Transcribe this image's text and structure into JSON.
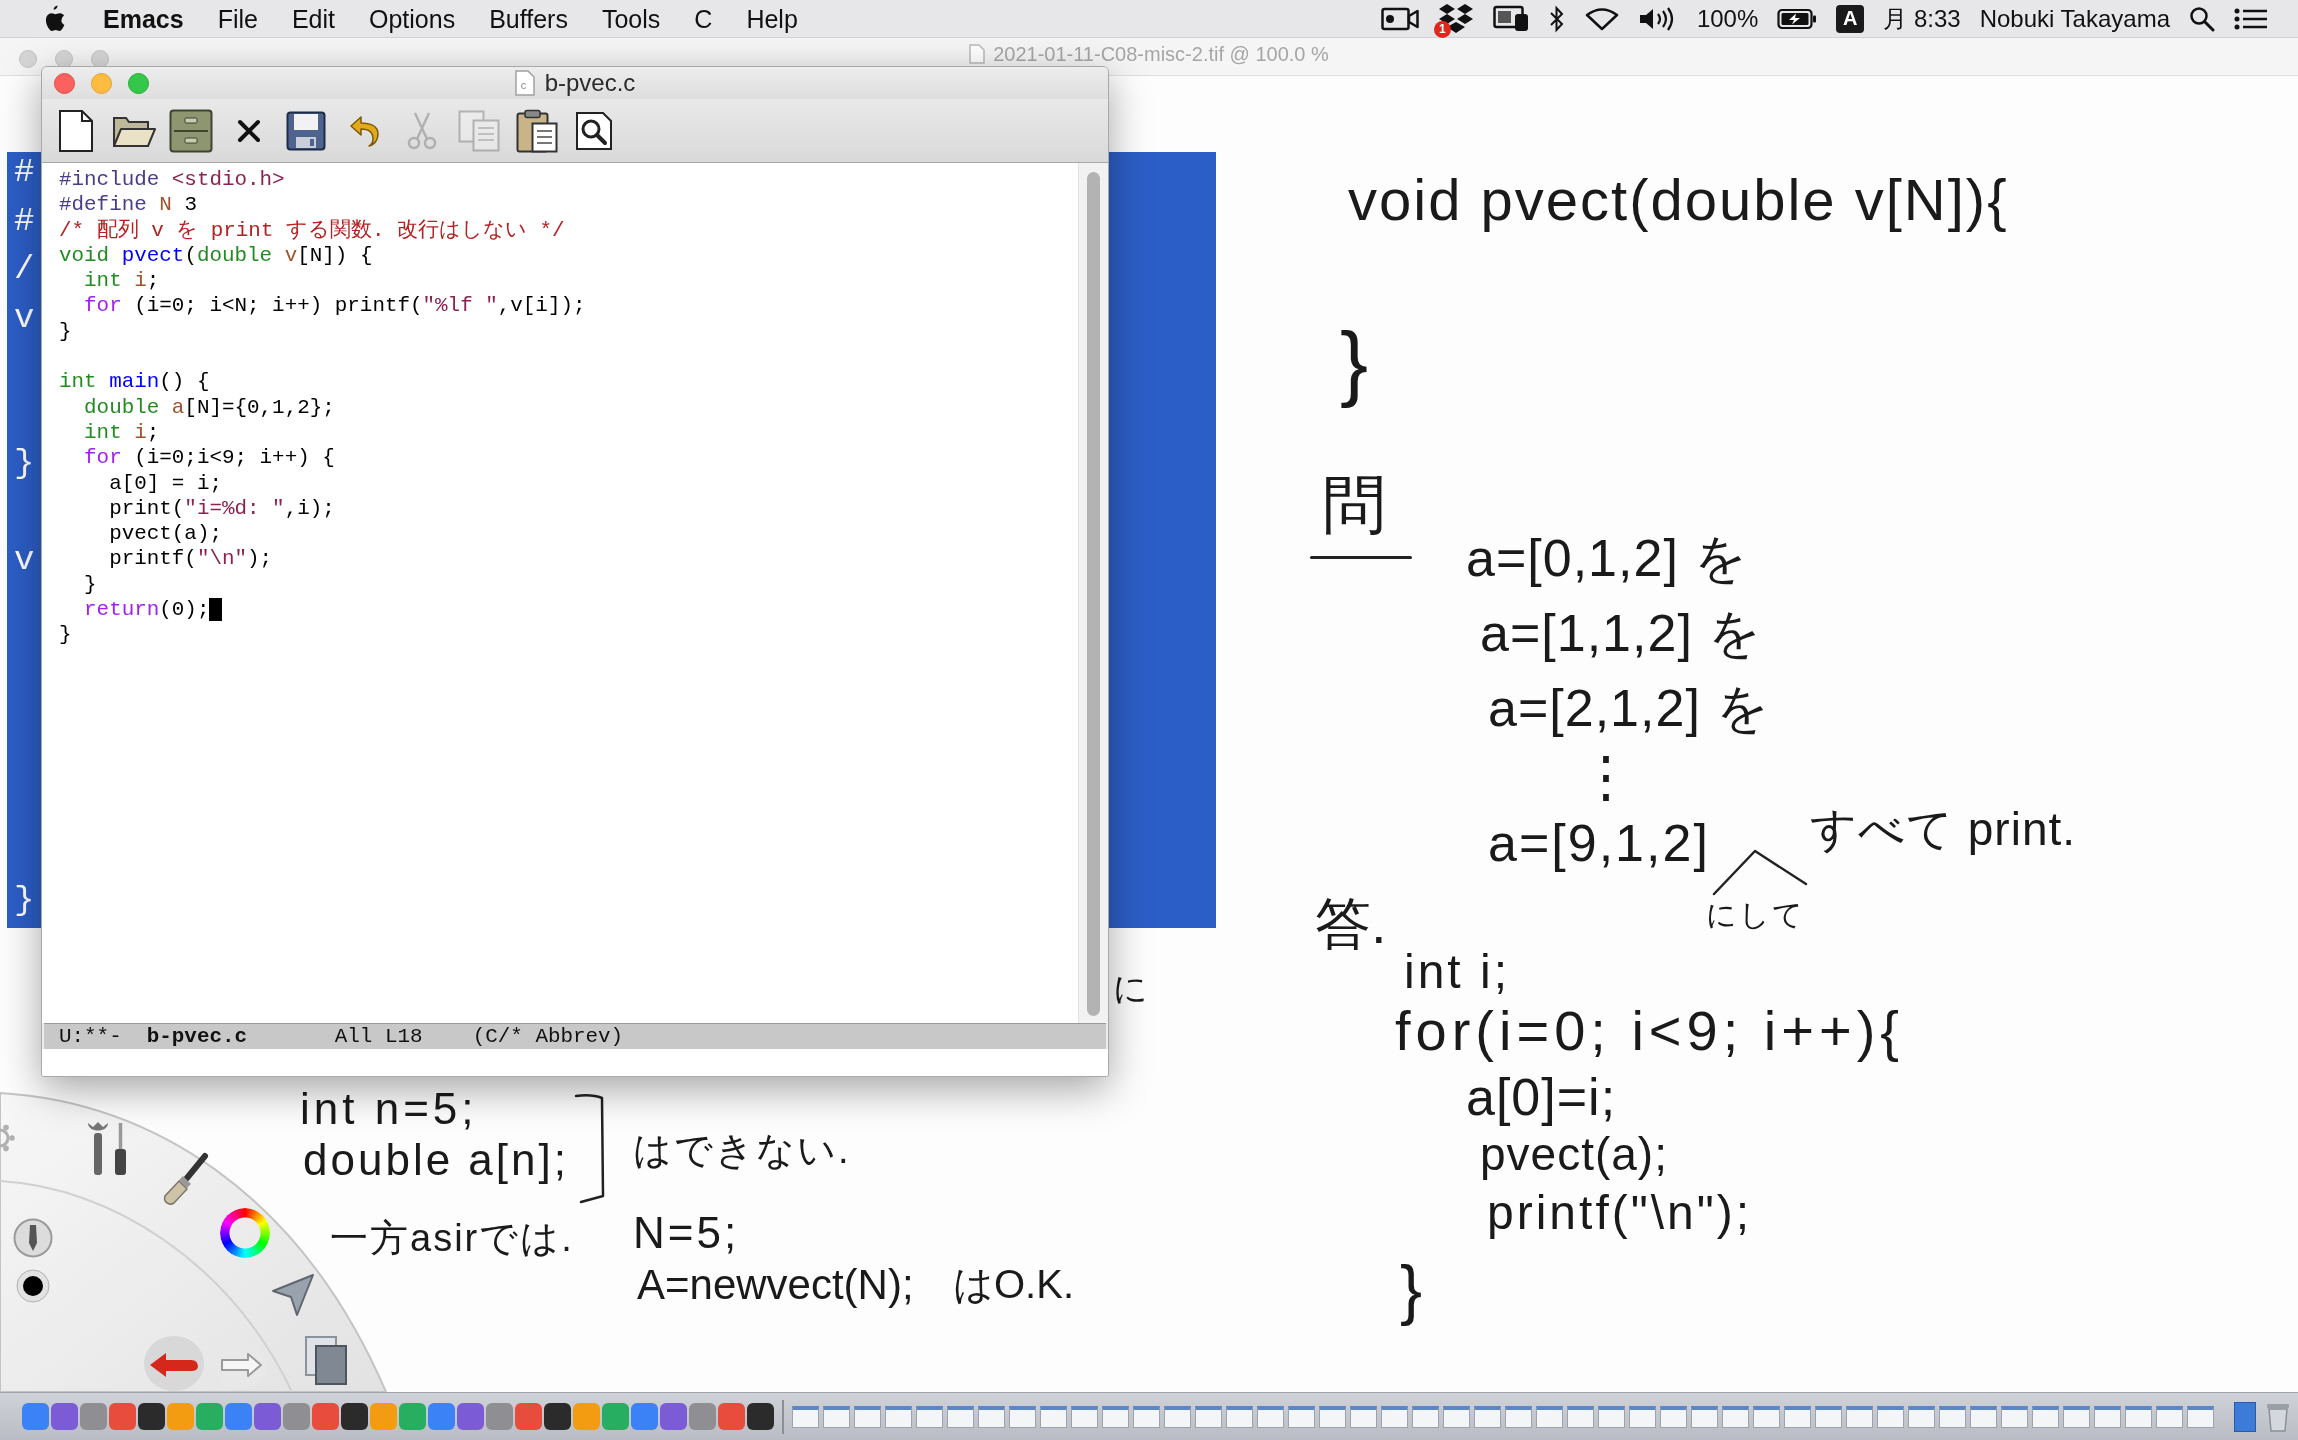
{
  "menu_bar": {
    "app_name": "Emacs",
    "menus": [
      "File",
      "Edit",
      "Options",
      "Buffers",
      "Tools",
      "C",
      "Help"
    ],
    "dropbox_badge": "1",
    "battery": "100%",
    "input_method": "A",
    "clock": "月 8:33",
    "user": "Nobuki Takayama"
  },
  "background_window": {
    "title": "2021-01-11-C08-misc-2.tif @ 100.0 %"
  },
  "slide": {
    "fragments": [
      "#",
      "#",
      "/",
      "v",
      "}",
      "v",
      "}"
    ]
  },
  "whiteboard": {
    "notes": [
      "void pvect(double v[N]){",
      "}",
      "問",
      "a=[0,1,2] を",
      "a=[1,1,2] を",
      "a=[2,1,2] を",
      "⋮",
      "a=[9,1,2]",
      "にして",
      "すべて print.",
      "答.",
      "int i;",
      "for(i=0; i<9; i++){",
      "a[0]=i;",
      "pvect(a);",
      "printf(\"\\n\");",
      "}",
      "に",
      "int n=5;",
      "double a[n];",
      "はできない.",
      "一方asirでは.",
      "N=5;",
      "A=newvect(N);",
      "はO.K."
    ]
  },
  "emacs": {
    "title": "b-pvec.c",
    "file_icon_letter": "c",
    "toolbar": [
      {
        "kind": "new",
        "disabled": false
      },
      {
        "kind": "open",
        "disabled": false
      },
      {
        "kind": "dired",
        "disabled": false
      },
      {
        "kind": "close",
        "disabled": false
      },
      {
        "kind": "save",
        "disabled": false
      },
      {
        "kind": "undo",
        "disabled": false
      },
      {
        "kind": "cut",
        "disabled": true
      },
      {
        "kind": "copy",
        "disabled": true
      },
      {
        "kind": "paste",
        "disabled": false
      },
      {
        "kind": "search",
        "disabled": false
      }
    ],
    "code": {
      "blocks": [
        {
          "lines": [
            {
              "tokens": [
                {
                  "text": "#include",
                  "kind": "preprocessor"
                },
                {
                  "text": " <stdio.h>",
                  "kind": "string"
                }
              ]
            },
            {
              "tokens": [
                {
                  "text": "#define",
                  "kind": "preprocessor"
                },
                {
                  "text": " N",
                  "kind": "variable"
                },
                {
                  "text": " 3",
                  "kind": "plain"
                }
              ]
            },
            {
              "tokens": [
                {
                  "text": "/* 配列 v を print する関数. 改行はしない */",
                  "kind": "comment"
                }
              ]
            },
            {
              "tokens": [
                {
                  "text": "void",
                  "kind": "type"
                },
                {
                  "text": " pvect",
                  "kind": "function"
                },
                {
                  "text": "(",
                  "kind": "plain"
                },
                {
                  "text": "double",
                  "kind": "type"
                },
                {
                  "text": " v",
                  "kind": "variable"
                },
                {
                  "text": "[N]) {",
                  "kind": "plain"
                }
              ]
            },
            {
              "tokens": [
                {
                  "text": "  int",
                  "kind": "type"
                },
                {
                  "text": " i",
                  "kind": "variable"
                },
                {
                  "text": ";",
                  "kind": "plain"
                }
              ]
            },
            {
              "tokens": [
                {
                  "text": "  for",
                  "kind": "keyword"
                },
                {
                  "text": " (i=0; i<N; i++) printf(",
                  "kind": "plain"
                },
                {
                  "text": "\"%lf \"",
                  "kind": "string"
                },
                {
                  "text": ",v[i]);",
                  "kind": "plain"
                }
              ]
            },
            {
              "tokens": [
                {
                  "text": "}",
                  "kind": "plain"
                }
              ]
            }
          ]
        },
        {
          "lines": [
            {
              "tokens": [
                {
                  "text": "int",
                  "kind": "type"
                },
                {
                  "text": " main",
                  "kind": "function"
                },
                {
                  "text": "() {",
                  "kind": "plain"
                }
              ]
            },
            {
              "tokens": [
                {
                  "text": "  double",
                  "kind": "type"
                },
                {
                  "text": " a",
                  "kind": "variable"
                },
                {
                  "text": "[N]={0,1,2};",
                  "kind": "plain"
                }
              ]
            },
            {
              "tokens": [
                {
                  "text": "  int",
                  "kind": "type"
                },
                {
                  "text": " i",
                  "kind": "variable"
                },
                {
                  "text": ";",
                  "kind": "plain"
                }
              ]
            },
            {
              "tokens": [
                {
                  "text": "  for",
                  "kind": "keyword"
                },
                {
                  "text": " (i=0;i<9; i++) {",
                  "kind": "plain"
                }
              ]
            },
            {
              "tokens": [
                {
                  "text": "    a[0] = i;",
                  "kind": "plain"
                }
              ]
            },
            {
              "tokens": [
                {
                  "text": "    print(",
                  "kind": "plain"
                },
                {
                  "text": "\"i=%d: \"",
                  "kind": "string"
                },
                {
                  "text": ",i);",
                  "kind": "plain"
                }
              ]
            },
            {
              "tokens": [
                {
                  "text": "    pvect(a);",
                  "kind": "plain"
                }
              ]
            },
            {
              "tokens": [
                {
                  "text": "    printf(",
                  "kind": "plain"
                },
                {
                  "text": "\"\\n\"",
                  "kind": "string"
                },
                {
                  "text": ");",
                  "kind": "plain"
                }
              ]
            },
            {
              "tokens": [
                {
                  "text": "  }",
                  "kind": "plain"
                }
              ]
            },
            {
              "tokens": [
                {
                  "text": "  return",
                  "kind": "keyword"
                },
                {
                  "text": "(0);",
                  "kind": "plain"
                },
                {
                  "kind": "cursor"
                }
              ]
            },
            {
              "tokens": [
                {
                  "text": "}",
                  "kind": "plain"
                }
              ]
            }
          ]
        }
      ]
    },
    "mode_line": {
      "status": "U:**-",
      "buffer": "b-pvec.c",
      "position": "All L18",
      "mode": "(C/* Abbrev)"
    }
  }
}
